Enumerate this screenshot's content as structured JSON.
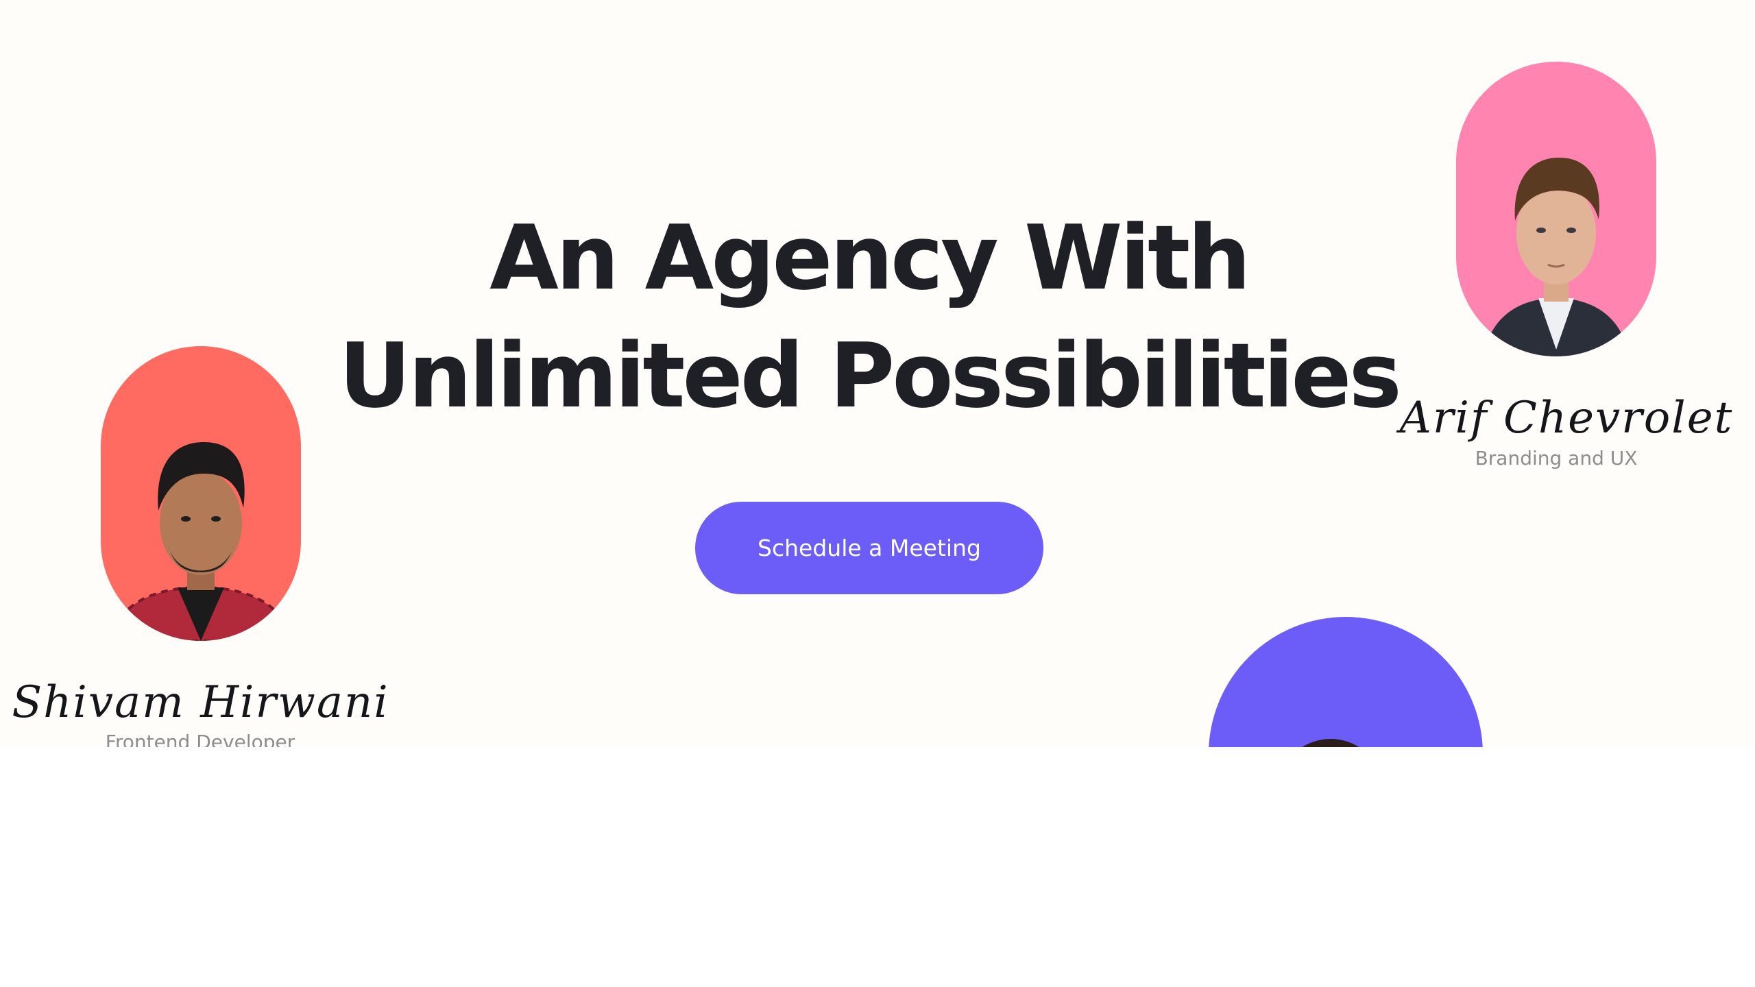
{
  "hero": {
    "headline_line1": "An Agency With",
    "headline_line2": "Unlimited Possibilities",
    "cta_label": "Schedule a Meeting"
  },
  "team": [
    {
      "signature": "Arif Chevrolet",
      "role": "Branding and UX",
      "pill_color": "#ff85b0"
    },
    {
      "signature": "Shivam Hirwani",
      "role": "Frontend Developer",
      "pill_color": "#ff6a61"
    },
    {
      "pill_color": "#6c5cf8"
    }
  ],
  "colors": {
    "accent": "#6c5cf8",
    "background": "#fffdfa",
    "text": "#1f2026",
    "muted": "#8d8d8d"
  }
}
